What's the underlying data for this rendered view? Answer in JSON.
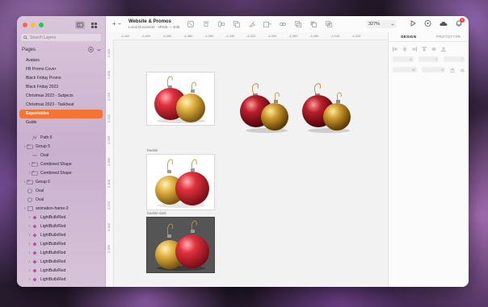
{
  "window": {
    "doc_title": "Website & Promos",
    "doc_subtitle": "Local Document · sRGB — Edit",
    "zoom": "327%",
    "notifications_count": "3"
  },
  "sidebar": {
    "search_placeholder": "Search Layers",
    "pages_header": "Pages",
    "pages": [
      {
        "label": "Avatars",
        "selected": false
      },
      {
        "label": "FB Promo Cover",
        "selected": false
      },
      {
        "label": "Black Friday Promo",
        "selected": false
      },
      {
        "label": "Black Friday 2023",
        "selected": false
      },
      {
        "label": "Christmas 2023 - Subjects",
        "selected": false
      },
      {
        "label": "Christmas 2023 - Taskheat",
        "selected": false
      },
      {
        "label": "Exportables",
        "selected": true
      },
      {
        "label": "Guide",
        "selected": false
      }
    ],
    "layers": [
      {
        "label": "Path 6",
        "indent": 1,
        "type": "path",
        "chevron": false
      },
      {
        "label": "Group 5",
        "indent": 0,
        "type": "group",
        "chevron": true
      },
      {
        "label": "Oval",
        "indent": 1,
        "type": "line",
        "chevron": false
      },
      {
        "label": "Combined Shape",
        "indent": 1,
        "type": "group",
        "chevron": true
      },
      {
        "label": "Combined Shape",
        "indent": 1,
        "type": "group",
        "chevron": true
      },
      {
        "label": "Group 6",
        "indent": 0,
        "type": "group",
        "chevron": true
      },
      {
        "label": "Oval",
        "indent": 0,
        "type": "oval",
        "chevron": false
      },
      {
        "label": "Oval",
        "indent": 0,
        "type": "oval",
        "chevron": false
      },
      {
        "label": "animation-frame-3",
        "indent": 0,
        "type": "artboard",
        "chevron": true
      },
      {
        "label": "LightBulb/Red",
        "indent": 1,
        "type": "symbol",
        "chevron": true
      },
      {
        "label": "LightBulb/Red",
        "indent": 1,
        "type": "symbol",
        "chevron": true
      },
      {
        "label": "LightBulb/Red",
        "indent": 1,
        "type": "symbol",
        "chevron": true
      },
      {
        "label": "LightBulb/Red",
        "indent": 1,
        "type": "symbol",
        "chevron": true
      },
      {
        "label": "LightBulb/Red",
        "indent": 1,
        "type": "symbol",
        "chevron": true
      },
      {
        "label": "LightBulb/Red",
        "indent": 1,
        "type": "symbol",
        "chevron": true
      },
      {
        "label": "LightBulb/Red",
        "indent": 1,
        "type": "symbol",
        "chevron": true
      },
      {
        "label": "LightBulb/Red",
        "indent": 1,
        "type": "symbol",
        "chevron": true
      }
    ]
  },
  "ruler": {
    "h_ticks": [
      "-4,440",
      "-4,420",
      "-4,400",
      "-4,380",
      "-4,360",
      "-4,340",
      "-4,320",
      "-4,300",
      "-4,280",
      "-4,260",
      "-4,240",
      "-4,220"
    ],
    "v_ticks": [
      "2,180",
      "2,200",
      "2,220",
      "2,240",
      "2,260",
      "2,280",
      "2,300",
      "2,320",
      "2,340",
      "2,360"
    ]
  },
  "canvas": {
    "artboard_labels": [
      "bauble",
      "bauble-dark"
    ]
  },
  "inspector": {
    "tabs": [
      {
        "label": "DESIGN",
        "active": true
      },
      {
        "label": "PROTOTYPE",
        "active": false
      }
    ]
  },
  "colors": {
    "accent": "#f47533",
    "bauble_red": "#c8202c",
    "bauble_gold": "#d9a53a"
  }
}
